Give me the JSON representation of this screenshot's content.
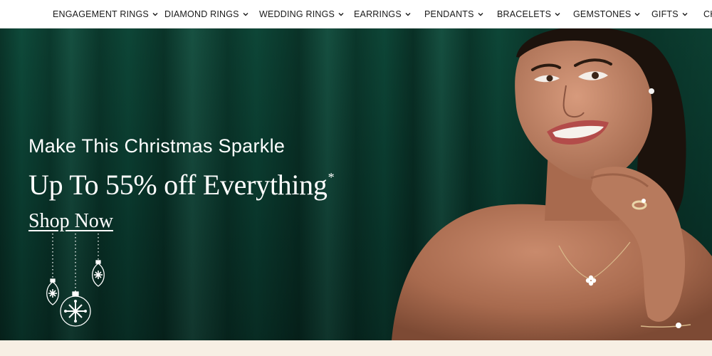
{
  "nav": {
    "items": [
      {
        "label": "ENGAGEMENT RINGS"
      },
      {
        "label": "DIAMOND RINGS"
      },
      {
        "label": "WEDDING RINGS"
      },
      {
        "label": "EARRINGS"
      },
      {
        "label": "PENDANTS"
      },
      {
        "label": "BRACELETS"
      },
      {
        "label": "GEMSTONES"
      },
      {
        "label": "GIFTS"
      },
      {
        "label": "CH"
      }
    ]
  },
  "hero": {
    "headline": "Make This Christmas Sparkle",
    "offer": "Up To 55% off Everything",
    "offer_mark": "*",
    "cta": "Shop Now"
  },
  "colors": {
    "hero_green": "#0b3d30",
    "text_white": "#ffffff",
    "strip_cream": "#f7efe4",
    "nav_text": "#1a1a1a"
  },
  "icons": [
    "chevron-down-icon",
    "snowflake-ornament-icon"
  ]
}
